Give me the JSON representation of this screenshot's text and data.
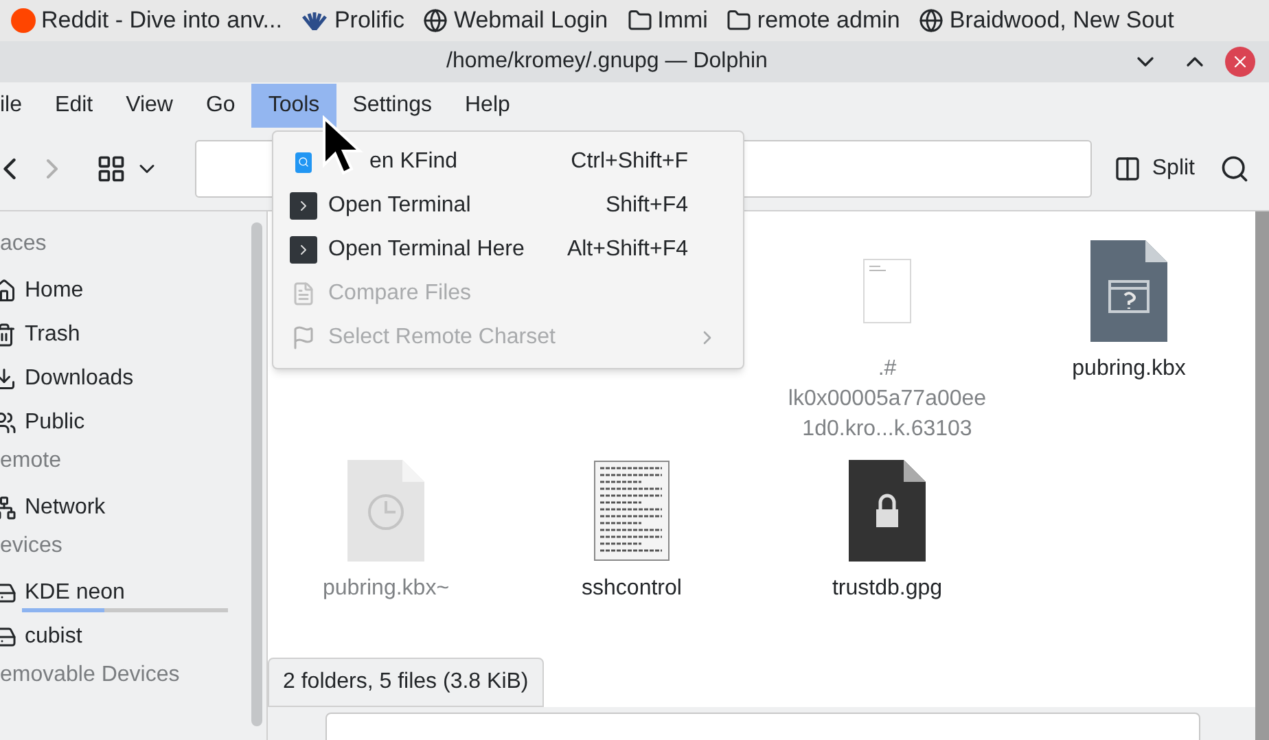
{
  "bookmarks": [
    {
      "label": "Reddit - Dive into anv...",
      "kind": "reddit"
    },
    {
      "label": "Prolific",
      "kind": "prolific"
    },
    {
      "label": "Webmail Login",
      "kind": "globe"
    },
    {
      "label": "Immi",
      "kind": "folder"
    },
    {
      "label": "remote admin",
      "kind": "folder"
    },
    {
      "label": "Braidwood, New Sout",
      "kind": "globe"
    }
  ],
  "window": {
    "title": "/home/kromey/.gnupg — Dolphin"
  },
  "menu_bar": [
    {
      "label": "ile",
      "selected": false
    },
    {
      "label": "Edit",
      "selected": false
    },
    {
      "label": "View",
      "selected": false
    },
    {
      "label": "Go",
      "selected": false
    },
    {
      "label": "Tools",
      "selected": true
    },
    {
      "label": "Settings",
      "selected": false
    },
    {
      "label": "Help",
      "selected": false
    }
  ],
  "toolbar": {
    "split": "Split"
  },
  "sidebar": [
    {
      "heading": "aces",
      "items": [
        {
          "label": "Home",
          "kind": "home"
        },
        {
          "label": "Trash",
          "kind": "trash"
        },
        {
          "label": "Downloads",
          "kind": "download"
        },
        {
          "label": "Public",
          "kind": "public"
        }
      ]
    },
    {
      "heading": "emote",
      "items": [
        {
          "label": "Network",
          "kind": "network"
        }
      ]
    },
    {
      "heading": "evices",
      "items": [
        {
          "label": "KDE neon",
          "kind": "drive",
          "level": 0.4
        },
        {
          "label": "cubist",
          "kind": "drive"
        }
      ]
    },
    {
      "heading": "emovable Devices"
    }
  ],
  "files": [
    {
      "name": ".#\nlk0x00005a77a00ee\n1d0.kro...k.63103",
      "kind": "blank",
      "hidden": true
    },
    {
      "name": "pubring.kbx",
      "kind": "unknown",
      "hidden": false
    },
    {
      "name": "pubring.kbx~",
      "kind": "backup",
      "hidden": true
    },
    {
      "name": "sshcontrol",
      "kind": "text",
      "hidden": false
    },
    {
      "name": "trustdb.gpg",
      "kind": "locked",
      "hidden": false
    }
  ],
  "status_bar": {
    "summary": "2 folders, 5 files (3.8 KiB)"
  },
  "tools_menu": [
    {
      "label": "en KFind",
      "shortcut": "Ctrl+Shift+F",
      "kind": "find",
      "disabled": false
    },
    {
      "label": "Open Terminal",
      "shortcut": "Shift+F4",
      "kind": "terminal",
      "disabled": false
    },
    {
      "label": "Open Terminal Here",
      "shortcut": "Alt+Shift+F4",
      "kind": "terminal",
      "disabled": false
    },
    {
      "label": "Compare Files",
      "kind": "compare",
      "disabled": true
    },
    {
      "label": "Select Remote Charset",
      "kind": "charset",
      "disabled": true,
      "submenu": true
    }
  ]
}
